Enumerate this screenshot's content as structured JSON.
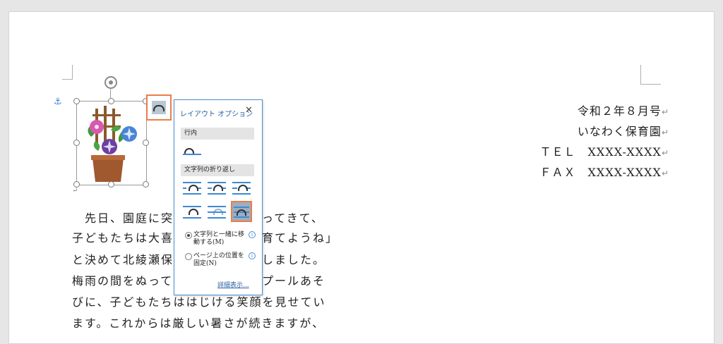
{
  "address": {
    "line1": "令和２年８月号",
    "line2": "いなわく保育園",
    "line3": "ＴＥＬ　XXXX-XXXX",
    "line4": "ＦＡＸ　XXXX-XXXX",
    "para_mark": "↵"
  },
  "body": {
    "line1": "先日、園庭に突",
    "line1b": "ってきて、",
    "line2": "子どもたちは大喜",
    "line2b": "育てようね」",
    "line3": "と決めて北綾瀬保",
    "line3b": "しました。",
    "line4": "梅雨の間をぬって",
    "line4b": "プールあそ",
    "line5": "びに、子どもたちははじける笑顔を見せてい",
    "line6": "ます。これからは厳しい暑さが続きますが、"
  },
  "anchor_icon": "anchor-icon",
  "layout_panel": {
    "title": "レイアウト オプション",
    "close": "✕",
    "section_inline": "行内",
    "section_wrap": "文字列の折り返し",
    "option_move": "文字列と一緒に移動する(M)",
    "option_move_l1": "文字列と一緒に移",
    "option_move_l2": "動する(M)",
    "option_fix_l1": "ページ上の位置を",
    "option_fix_l2": "固定(N)",
    "info": "i",
    "more_link": "詳細表示..."
  }
}
